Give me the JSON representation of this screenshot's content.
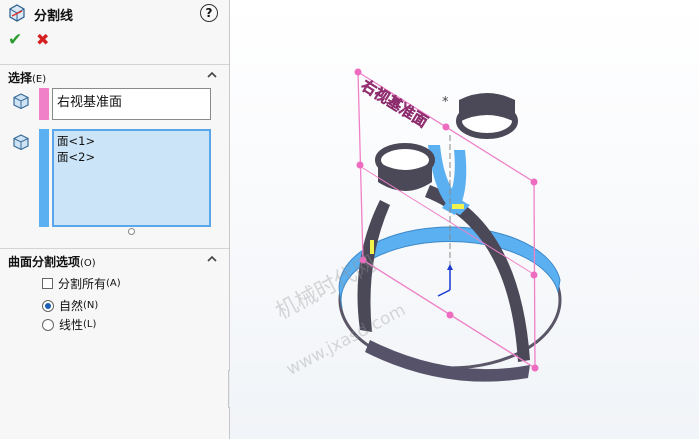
{
  "header": {
    "title": "分割线",
    "help": "?"
  },
  "selection_group": {
    "title": "选择",
    "shortcut": "(E)",
    "plane": "右视基准面",
    "faces": [
      "面<1>",
      "面<2>"
    ]
  },
  "options_group": {
    "title": "曲面分割选项",
    "shortcut": "(O)",
    "split_all": {
      "label": "分割所有",
      "shortcut": "(A)",
      "checked": false
    },
    "natural": {
      "label": "自然",
      "shortcut": "(N)",
      "selected": true
    },
    "linear": {
      "label": "线性",
      "shortcut": "(L)",
      "selected": false
    }
  },
  "viewport": {
    "plane_label": "右视基准面",
    "watermark": "机械时代网",
    "watermark_url": "www.jxasd.com"
  },
  "colors": {
    "plane_pink": "#f080c8",
    "face_blue": "#5ab0f0",
    "ok": "#2f9d32",
    "cancel": "#d62020"
  }
}
